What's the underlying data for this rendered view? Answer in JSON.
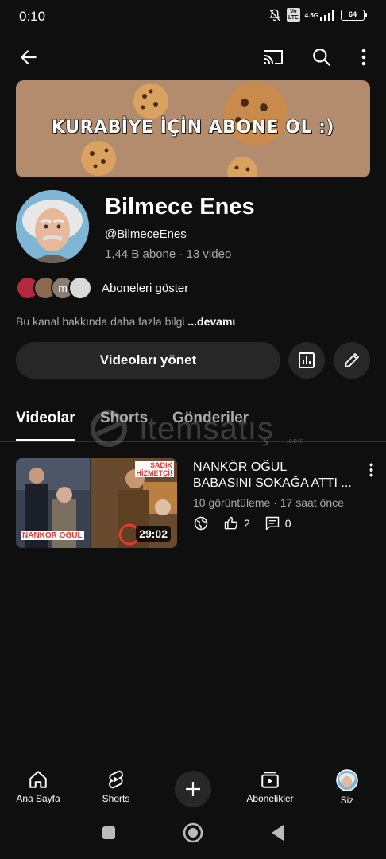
{
  "status_bar": {
    "time": "0:10",
    "volte_badge_line1": "Vo",
    "volte_badge_line2": "LTE",
    "network": "4.5G",
    "battery": "64"
  },
  "icons": {
    "back": "arrow-left-icon",
    "cast": "cast-icon",
    "search": "search-icon",
    "more": "more-vertical-icon",
    "analytics": "bar-chart-icon",
    "edit": "pencil-icon"
  },
  "banner": {
    "text": "KURABİYE İÇİN ABONE OL :)",
    "background": "#b38c6e"
  },
  "channel": {
    "name": "Bilmece Enes",
    "handle": "@BilmeceEnes",
    "stats": "1,44 B abone · 13 video",
    "subscribers_link": "Aboneleri göster",
    "subscriber_avatar_letter": "m",
    "about_text": "Bu kanal hakkında daha fazla bilgi",
    "about_more": "...devamı"
  },
  "actions": {
    "manage_videos": "Videoları yönet"
  },
  "tabs": [
    {
      "label": "Videolar",
      "active": true
    },
    {
      "label": "Shorts",
      "active": false
    },
    {
      "label": "Gönderiler",
      "active": false
    }
  ],
  "watermark": {
    "text": "itemsatış",
    "suffix": ".com"
  },
  "video": {
    "title": "NANKÖR OĞUL BABASINI SOKAĞA ATTI ...",
    "title_line1": "NANKÖR OĞUL",
    "title_line2": "BABASINI SOKAĞA ATTI ...",
    "meta": "10 görüntüleme · 17 saat önce",
    "likes": "2",
    "comments": "0",
    "duration": "29:02",
    "thumb_label_left": "NANKÖR OĞUL",
    "thumb_label_right_1": "SADIK",
    "thumb_label_right_2": "HİZMETÇİ!"
  },
  "bottom_nav": [
    {
      "label": "Ana Sayfa",
      "icon": "home-icon"
    },
    {
      "label": "Shorts",
      "icon": "shorts-icon"
    },
    {
      "label": "",
      "icon": "plus-icon"
    },
    {
      "label": "Abonelikler",
      "icon": "subscriptions-icon"
    },
    {
      "label": "Siz",
      "icon": "profile-avatar"
    }
  ],
  "colors": {
    "background": "#0f0f0f",
    "surface": "#272727",
    "text_secondary": "#aaaaaa",
    "accent_red": "#e53935"
  }
}
